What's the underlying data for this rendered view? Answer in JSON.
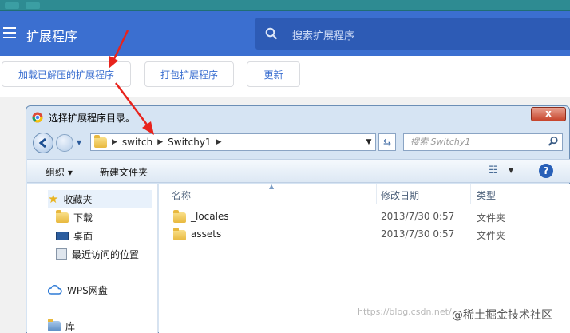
{
  "header": {
    "title": "扩展程序",
    "search_placeholder": "搜索扩展程序"
  },
  "toolbar": {
    "load_unpacked": "加载已解压的扩展程序",
    "pack": "打包扩展程序",
    "update": "更新"
  },
  "dialog": {
    "title": "选择扩展程序目录。",
    "close_label": "x",
    "breadcrumb": [
      "switch",
      "Switchy1"
    ],
    "search_placeholder": "搜索 Switchy1",
    "organize": "组织 ▾",
    "new_folder": "新建文件夹",
    "help": "?",
    "nav": {
      "favorites": "收藏夹",
      "downloads": "下载",
      "desktop": "桌面",
      "recent": "最近访问的位置",
      "wps": "WPS网盘",
      "library": "库"
    },
    "columns": {
      "name": "名称",
      "modified": "修改日期",
      "type": "类型"
    },
    "files": [
      {
        "name": "_locales",
        "modified": "2013/7/30 0:57",
        "type": "文件夹"
      },
      {
        "name": "assets",
        "modified": "2013/7/30 0:57",
        "type": "文件夹"
      }
    ]
  },
  "watermark": {
    "url": "https://blog.csdn.net/...",
    "brand": "@稀土掘金技术社区"
  },
  "colors": {
    "header": "#3b6fd0",
    "link": "#3b6fd0",
    "arrow": "#e8231c"
  }
}
